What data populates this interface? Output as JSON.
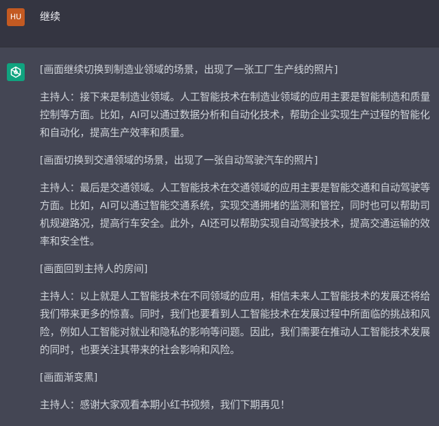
{
  "user": {
    "avatar_initials": "HU",
    "avatar_color": "#c35a22",
    "message": "继续"
  },
  "assistant": {
    "avatar_icon": "openai-logo-icon",
    "avatar_color": "#10a37f",
    "paragraphs": [
      "[画面继续切换到制造业领域的场景，出现了一张工厂生产线的照片]",
      "主持人：接下来是制造业领域。人工智能技术在制造业领域的应用主要是智能制造和质量控制等方面。比如，AI可以通过数据分析和自动化技术，帮助企业实现生产过程的智能化和自动化，提高生产效率和质量。",
      "[画面切换到交通领域的场景，出现了一张自动驾驶汽车的照片]",
      "主持人：最后是交通领域。人工智能技术在交通领域的应用主要是智能交通和自动驾驶等方面。比如，AI可以通过智能交通系统，实现交通拥堵的监测和管控，同时也可以帮助司机规避路况，提高行车安全。此外，AI还可以帮助实现自动驾驶技术，提高交通运输的效率和安全性。",
      "[画面回到主持人的房间]",
      "主持人：以上就是人工智能技术在不同领域的应用，相信未来人工智能技术的发展还将给我们带来更多的惊喜。同时，我们也要看到人工智能技术在发展过程中所面临的挑战和风险，例如人工智能对就业和隐私的影响等问题。因此，我们需要在推动人工智能技术发展的同时，也要关注其带来的社会影响和风险。",
      "[画面渐变黑]",
      "主持人：感谢大家观看本期小红书视频，我们下期再见！"
    ]
  }
}
